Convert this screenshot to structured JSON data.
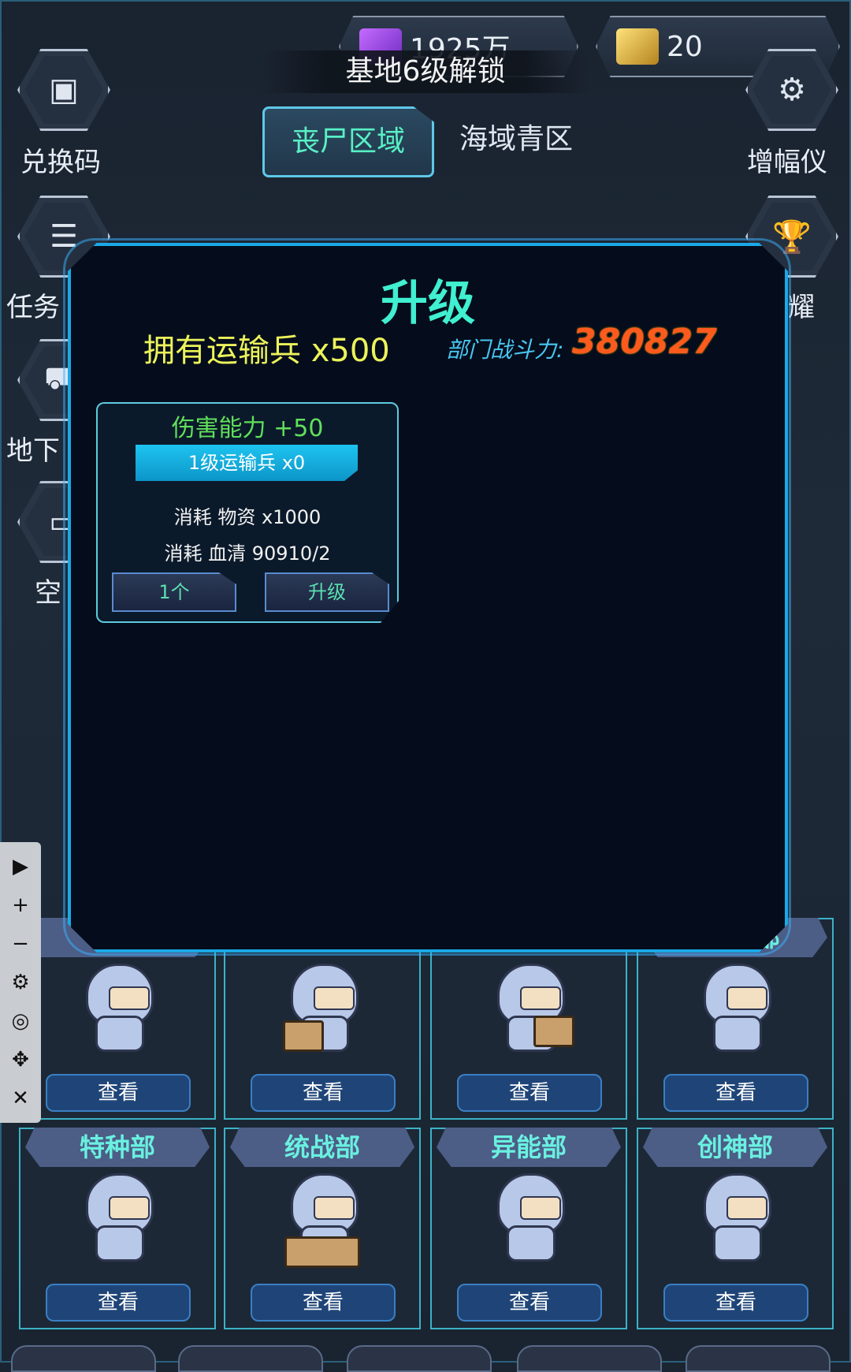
{
  "currency": {
    "gems": "1925万",
    "gold": "20",
    "gem_icon": "gem-chest-icon",
    "gold_icon": "gold-pile-icon"
  },
  "unlock_banner": "基地6级解锁",
  "side_left": [
    {
      "label": "兑换码",
      "icon": "chest-icon"
    },
    {
      "label": "任务",
      "icon": "list-icon"
    },
    {
      "label": "地下",
      "icon": "cart-icon"
    },
    {
      "label": "空",
      "icon": "folder-icon"
    }
  ],
  "side_right": [
    {
      "label": "增幅仪",
      "icon": "gear-icon"
    },
    {
      "label": "荣耀",
      "icon": "trophy-icon"
    }
  ],
  "tabs": [
    {
      "label": "丧尸区域",
      "active": true
    },
    {
      "label": "海域青区",
      "active": false
    }
  ],
  "modal": {
    "title": "升级",
    "owned": "拥有运输兵 x500",
    "power_label": "部门战斗力:",
    "power_value": "380827",
    "card": {
      "damage": "伤害能力 +50",
      "level_unit": "1级运输兵 x0",
      "cost1": "消耗 物资 x1000",
      "cost2": "消耗 血清 90910/2",
      "qty_button": "1个",
      "upgrade_button": "升级"
    }
  },
  "debug_toolbar": [
    "play-icon",
    "zoom-in-icon",
    "zoom-out-icon",
    "settings-icon",
    "hide-icon",
    "move-icon",
    "close-icon"
  ],
  "departments": [
    {
      "name": "战",
      "view": "查看"
    },
    {
      "name": "",
      "view": "查看"
    },
    {
      "name": "",
      "view": "查看"
    },
    {
      "name": "部",
      "view": "查看"
    },
    {
      "name": "特种部",
      "view": "查看"
    },
    {
      "name": "统战部",
      "view": "查看"
    },
    {
      "name": "异能部",
      "view": "查看"
    },
    {
      "name": "创神部",
      "view": "查看"
    }
  ],
  "colors": {
    "accent_cyan": "#1aa9e6",
    "title_green": "#40f0d0",
    "power_orange": "#ff5a1e",
    "owned_yellow": "#ecf35a"
  }
}
